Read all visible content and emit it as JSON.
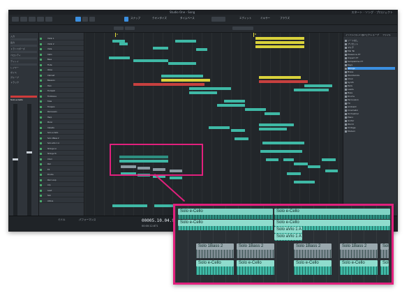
{
  "window": {
    "title": "Studio One - Song",
    "right_status": "スタート · ソング · プロジェクト"
  },
  "toolbar": {
    "labels": [
      "スナップ",
      "クオンタイズ",
      "タイムベース",
      "エディット",
      "ミキサー",
      "ブラウズ"
    ]
  },
  "inspector": {
    "labels": [
      "入力",
      "出力",
      "トランスポーズ",
      "ベロシティ",
      "ディレイ",
      "レイヤー",
      "ボイス",
      "グループ",
      "トラック"
    ],
    "channel_label": "Solo e-Cello"
  },
  "tracks": [
    "Violin 1",
    "Violin 2",
    "Viola",
    "Cello",
    "Bass",
    "Flute",
    "Oboe",
    "Clarinet",
    "Bassoon",
    "Horn",
    "Trumpet",
    "Trombone",
    "Tuba",
    "Timpani",
    "Percussion",
    "Harp",
    "Piano",
    "Celesta",
    "Solo e-Cello",
    "Solo 1Bass 2",
    "Solo aVio 1 A",
    "Strings Lo",
    "Strings Hi",
    "Choir",
    "Pad",
    "FX",
    "Drums",
    "Perc Loop",
    "Arp",
    "Lead",
    "Sub",
    "Atmos"
  ],
  "markers": [
    "A",
    "B"
  ],
  "browser": {
    "tabs": [
      "インストゥルメント",
      "エフェクト",
      "ループ",
      "ファイル"
    ],
    "items": [
      "ソートなし",
      "プリセット",
      "マルチ",
      "Mai Tai",
      "Presence XT",
      "Impact XT",
      "SampleOne XT",
      "Keys",
      "Strings",
      "Brass",
      "Woodwinds",
      "Choir",
      "Synth",
      "Pads",
      "Leads",
      "Bass",
      "Drums",
      "Percussion",
      "FX",
      "Ambient",
      "Cinematic",
      "Orchestral",
      "Piano",
      "Guitar",
      "World",
      "Vintage",
      "Modern"
    ],
    "selected_index": 8
  },
  "transport": {
    "time_main": "00005.10.04.90",
    "time_sub": "00:00:12.671",
    "tempo": "120.00",
    "signature": "4 / 4",
    "labels": [
      "ミドル",
      "パフォーマンス",
      "メトロノーム",
      "テンポ",
      "拍子"
    ]
  },
  "zoom_clips": [
    {
      "label": "Solo e-Cello"
    },
    {
      "label": "Solo e-Cello"
    },
    {
      "label": "Solo e-Cello"
    },
    {
      "label": "Solo e-Cello"
    },
    {
      "label": "Solo aVio 1 A"
    },
    {
      "label": "Solo aVio 1 A"
    },
    {
      "label": "Solo 1Bass 2"
    },
    {
      "label": "Solo 1Bass 2"
    },
    {
      "label": "Solo 1Bass 2"
    },
    {
      "label": "Solo 1Bass 2"
    },
    {
      "label": "Solo 1Bass 2"
    },
    {
      "label": "Solo e-Cello"
    },
    {
      "label": "Solo e-Cello"
    },
    {
      "label": "Solo e-Cello"
    },
    {
      "label": "Solo e-Cello"
    },
    {
      "label": "Solo e-Cello"
    }
  ],
  "colors": {
    "accent": "#3b8fe0",
    "clip_teal": "#3fb9a6",
    "clip_yellow": "#d9d23b",
    "clip_red": "#c7403f",
    "highlight": "#e2207d"
  }
}
